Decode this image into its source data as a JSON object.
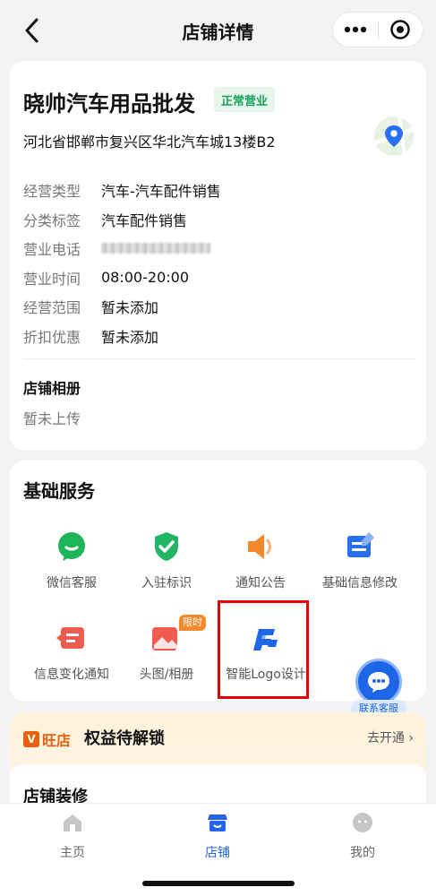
{
  "header": {
    "title": "店铺详情"
  },
  "store": {
    "name": "晓帅汽车用品批发",
    "status": "正常营业",
    "address": "河北省邯郸市复兴区华北汽车城13楼B2"
  },
  "info": [
    {
      "key": "经营类型",
      "value": "汽车-汽车配件销售"
    },
    {
      "key": "分类标签",
      "value": "汽车配件销售"
    },
    {
      "key": "营业电话",
      "value": ""
    },
    {
      "key": "营业时间",
      "value": "08:00-20:00"
    },
    {
      "key": "经营范围",
      "value": "暂未添加"
    },
    {
      "key": "折扣优惠",
      "value": "暂未添加"
    }
  ],
  "album": {
    "title": "店铺相册",
    "empty": "暂未上传"
  },
  "services": {
    "title": "基础服务",
    "items": [
      {
        "label": "微信客服",
        "icon": "wechat-chat-icon"
      },
      {
        "label": "入驻标识",
        "icon": "verified-shield-icon"
      },
      {
        "label": "通知公告",
        "icon": "speaker-icon"
      },
      {
        "label": "基础信息修改",
        "icon": "edit-form-icon"
      },
      {
        "label": "信息变化通知",
        "icon": "notification-card-icon"
      },
      {
        "label": "头图/相册",
        "icon": "image-icon",
        "badge": "限时"
      },
      {
        "label": "智能Logo设计",
        "icon": "logo-design-icon"
      }
    ]
  },
  "float_cs": {
    "label": "联系客服"
  },
  "wangdian": {
    "logo": "旺店",
    "rights": "权益待解锁",
    "link": "去开通"
  },
  "decor": {
    "title": "店铺装修"
  },
  "tabs": [
    {
      "label": "主页"
    },
    {
      "label": "店铺"
    },
    {
      "label": "我的"
    }
  ],
  "colors": {
    "accent": "#2563eb",
    "status_green": "#1aa15c",
    "highlight": "#e60000"
  }
}
